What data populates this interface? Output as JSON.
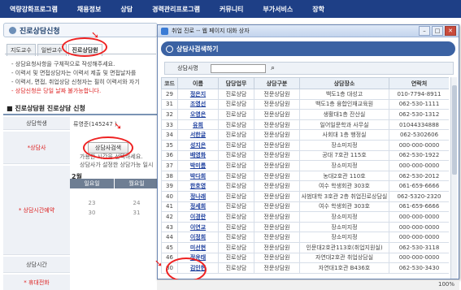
{
  "topnav": [
    "역량강화프로그램",
    "채용정보",
    "상담",
    "경력관리프로그램",
    "커뮤니티",
    "부가서비스",
    "장학"
  ],
  "page": {
    "title": "진로상담신청",
    "tabs": [
      "지도교수",
      "일반교수",
      "진로상담원"
    ],
    "notices": [
      "- 상담요청사항을 구체적으로 작성해주세요.",
      "- 이력서 및 면접상담자는 이력서 제출 및 면접날자를",
      "- 이력서, 면접, 취업상담 신청자는 필히 이력서와 자기",
      "- 상담신청은 당일 날짜 불가능합니다."
    ],
    "section_title": "■ 진로상담원 진로상담 신청",
    "labels": {
      "student": "상담학생",
      "counselor": "*상담사",
      "reservation": "* 상담시간예약",
      "time": "상담시간",
      "phone": "* 휴대전화"
    },
    "student_value": "류영준(145247 )",
    "consult_button": "상담사검색",
    "hint1": "가용한 시간을 선택하세요.",
    "hint2": "상담사가 설정한 상담가능 일시",
    "month": "2월",
    "weekdays": [
      "일요일",
      "월요일"
    ],
    "cal_rows": [
      [
        "",
        ""
      ],
      [
        "23",
        "24"
      ],
      [
        "30",
        "31"
      ]
    ]
  },
  "popup": {
    "window_title": "취업 진로 -- 웹 페이지 대화 상자",
    "header": "상담사검색하기",
    "search_label": "상담사명",
    "columns": [
      "코드",
      "이름",
      "담당업무",
      "상담구분",
      "상담장소",
      "연락처"
    ],
    "rows": [
      [
        "29",
        "정은지",
        "진로상담",
        "전문상담원",
        "백도1층 대성고",
        "010-7794-8911"
      ],
      [
        "31",
        "조영선",
        "진로상담",
        "전문상담원",
        "백도1층 융합인재교육원",
        "062-530-1111"
      ],
      [
        "32",
        "오영은",
        "진로상담",
        "전문상담원",
        "생활대1층 잔산실",
        "062-530-1312"
      ],
      [
        "33",
        "유희",
        "진로상담",
        "전문상담원",
        "일어일문학과 사무실",
        "01044334888"
      ],
      [
        "34",
        "서한글",
        "진로상담",
        "전문상담원",
        "사회대 1층 행정실",
        "062-5302606"
      ],
      [
        "35",
        "성지은",
        "진로상담",
        "전문상담원",
        "장소미지정",
        "000-000-0000"
      ],
      [
        "36",
        "배영화",
        "진로상담",
        "전문상담원",
        "공대 7호관 115호",
        "062-530-1922"
      ],
      [
        "37",
        "박미름",
        "진로상담",
        "전문상담원",
        "장소미지정",
        "000-000-0000"
      ],
      [
        "38",
        "박다희",
        "진로상담",
        "전문상담원",
        "농대2호관 110호",
        "062-530-2012"
      ],
      [
        "39",
        "한호영",
        "진로상담",
        "전문상담원",
        "여수 학생회관 303호",
        "061-659-6666"
      ],
      [
        "40",
        "정나래",
        "진로상담",
        "전문상담원",
        "사범대학 3호관 2층 취업진로상담실",
        "062-5320-2320"
      ],
      [
        "41",
        "정세희",
        "진로상담",
        "전문상담원",
        "여수 학생회관 303호",
        "061-659-6666"
      ],
      [
        "42",
        "이경란",
        "진로상담",
        "전문상담원",
        "장소미지정",
        "000-000-0000"
      ],
      [
        "43",
        "이연교",
        "진로상담",
        "전문상담원",
        "장소미지정",
        "000-000-0000"
      ],
      [
        "44",
        "이정희",
        "진로상담",
        "전문상담원",
        "장소미지정",
        "000-000-0000"
      ],
      [
        "45",
        "미선현",
        "진로상담",
        "전문상담원",
        "인문대2호관113호(취업지원실)",
        "062-530-3118"
      ],
      [
        "46",
        "정윤태",
        "진로상담",
        "전문상담원",
        "자연대2호관 취업상담실",
        "000-000-0000"
      ],
      [
        "80",
        "김인현",
        "진로상담",
        "전문상담원",
        "자연대1호관 B436호",
        "062-530-3430"
      ]
    ]
  },
  "status": {
    "zoom": "100%"
  },
  "colors": {
    "nav": "#1e3f86",
    "popup_header": "#3b62a3",
    "annotation": "#e22222"
  }
}
